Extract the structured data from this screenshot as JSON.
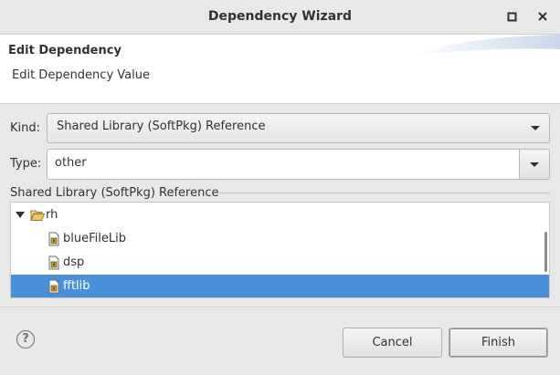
{
  "window": {
    "title": "Dependency Wizard",
    "maximize_icon": "maximize-icon",
    "close_icon": "close-icon"
  },
  "banner": {
    "title": "Edit Dependency",
    "subtitle": "Edit Dependency Value"
  },
  "form": {
    "kind_label": "Kind:",
    "kind_value": "Shared Library (SoftPkg) Reference",
    "type_label": "Type:",
    "type_value": "other"
  },
  "group": {
    "label": "Shared Library (SoftPkg) Reference",
    "tree": {
      "root": {
        "label": "rh",
        "icon": "folder-open-icon",
        "expanded": true
      },
      "children": [
        {
          "label": "blueFileLib",
          "icon": "library-file-icon",
          "selected": false
        },
        {
          "label": "dsp",
          "icon": "library-file-icon",
          "selected": false
        },
        {
          "label": "fftlib",
          "icon": "library-file-icon",
          "selected": true
        }
      ]
    }
  },
  "footer": {
    "help": "?",
    "cancel": "Cancel",
    "finish": "Finish"
  },
  "colors": {
    "selection": "#4a90d9",
    "background": "#e8e8e7"
  }
}
